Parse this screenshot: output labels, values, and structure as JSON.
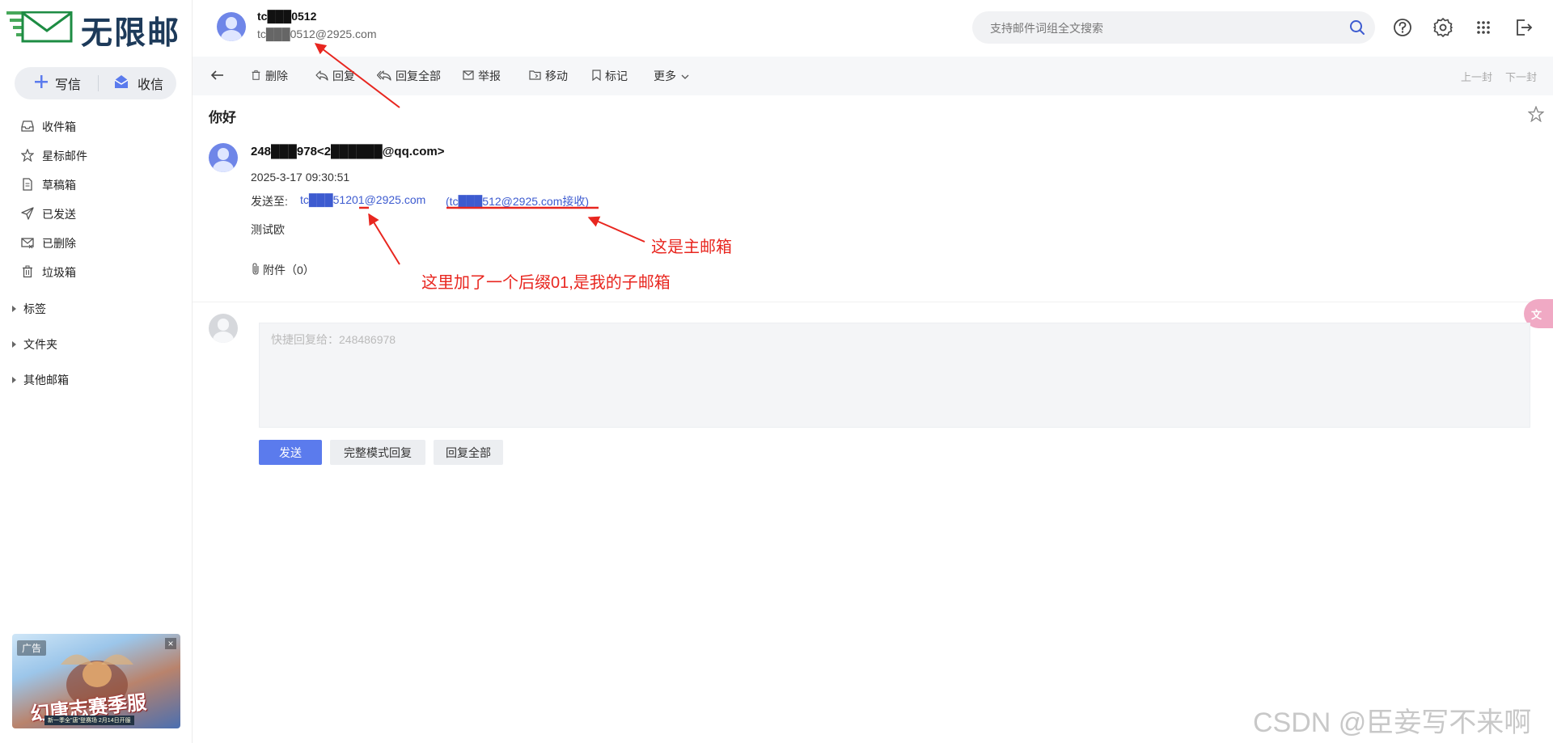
{
  "app": {
    "logo_text": "无限邮",
    "brand_color": "#1d3a5a",
    "accent": "#5b7bed"
  },
  "account": {
    "name": "tc███0512",
    "email": "tc███0512@2925.com"
  },
  "sidebar": {
    "compose_label": "写信",
    "receive_label": "收信",
    "folders": [
      {
        "label": "收件箱",
        "icon": "inbox-icon"
      },
      {
        "label": "星标邮件",
        "icon": "star-icon"
      },
      {
        "label": "草稿箱",
        "icon": "draft-icon"
      },
      {
        "label": "已发送",
        "icon": "send-icon"
      },
      {
        "label": "已删除",
        "icon": "deleted-mail-icon"
      },
      {
        "label": "垃圾箱",
        "icon": "trash-icon"
      }
    ],
    "groups": [
      {
        "label": "标签"
      },
      {
        "label": "文件夹"
      },
      {
        "label": "其他邮箱"
      }
    ],
    "ad": {
      "label": "广告",
      "close": "×",
      "title": "幻唐志赛季服",
      "subtitle": "新一季全\"唐\"登赛场 2月14日开服"
    }
  },
  "header": {
    "search_placeholder": "支持邮件词组全文搜索",
    "icons": [
      "search-icon",
      "help-icon",
      "gear-icon",
      "apps-grid-icon",
      "logout-icon"
    ]
  },
  "toolbar": {
    "back_icon": "arrow-left-icon",
    "delete": "删除",
    "reply": "回复",
    "reply_all": "回复全部",
    "report": "举报",
    "move": "移动",
    "mark": "标记",
    "more": "更多",
    "prev": "上一封",
    "next": "下一封"
  },
  "mail": {
    "subject": "你好",
    "sender": "248███978<2██████@qq.com>",
    "datetime": "2025-3-17 09:30:51",
    "to_label": "发送至:",
    "to_address": "tc███51201@2925.com",
    "received_via": "(tc███512@2925.com接收)",
    "body": "测试欧",
    "attachments": "附件（0）"
  },
  "quick_reply": {
    "placeholder": "快捷回复给：248486978",
    "send": "发送",
    "full_mode": "完整模式回复",
    "reply_all": "回复全部"
  },
  "annotations": {
    "main_mailbox": "这是主邮箱",
    "sub_mailbox": "这里加了一个后缀01,是我的子邮箱",
    "color": "#e8261f"
  },
  "watermark": "CSDN @臣妾写不来啊"
}
